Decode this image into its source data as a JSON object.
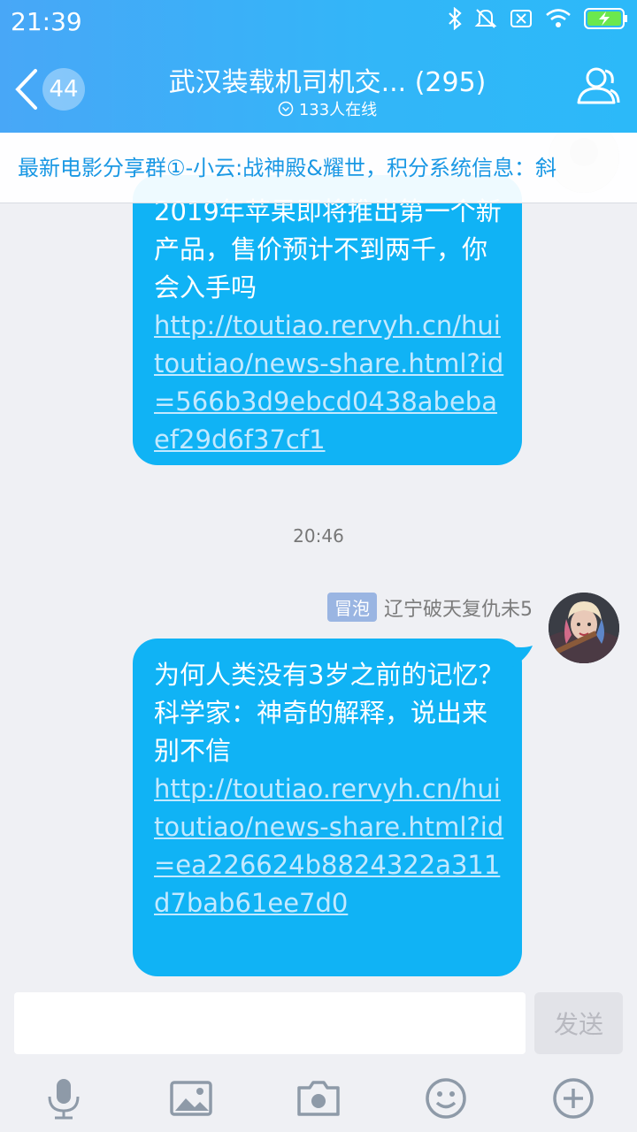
{
  "status_bar": {
    "time": "21:39"
  },
  "header": {
    "unread_count": "44",
    "title": "武汉装载机司机交... (295)",
    "online": "133人在线"
  },
  "notice": {
    "text": "最新电影分享群①-小云:战神殿&耀世，积分系统信息：斜"
  },
  "messages": [
    {
      "text": "2019年苹果即将推出第一个新产品，售价预计不到两千，你会入手吗",
      "link": "http://toutiao.rervyh.cn/huitoutiao/news-share.html?id=566b3d9ebcd0438abebaef29d6f37cf1"
    },
    {
      "text": "为何人类没有3岁之前的记忆？科学家：神奇的解释，说出来别不信",
      "link": "http://toutiao.rervyh.cn/huitoutiao/news-share.html?id=ea226624b8824322a311d7bab61ee7d0"
    }
  ],
  "timestamp": "20:46",
  "sender": {
    "tag": "冒泡",
    "name": "辽宁破天复仇未5"
  },
  "input": {
    "placeholder": "",
    "send_label": "发送"
  },
  "toolbar": [
    "microphone-icon",
    "image-icon",
    "camera-icon",
    "emoji-icon",
    "plus-icon"
  ],
  "colors": {
    "header": "#32b6f8",
    "bubble": "#10b3f5",
    "notice_text": "#1a98e4"
  }
}
